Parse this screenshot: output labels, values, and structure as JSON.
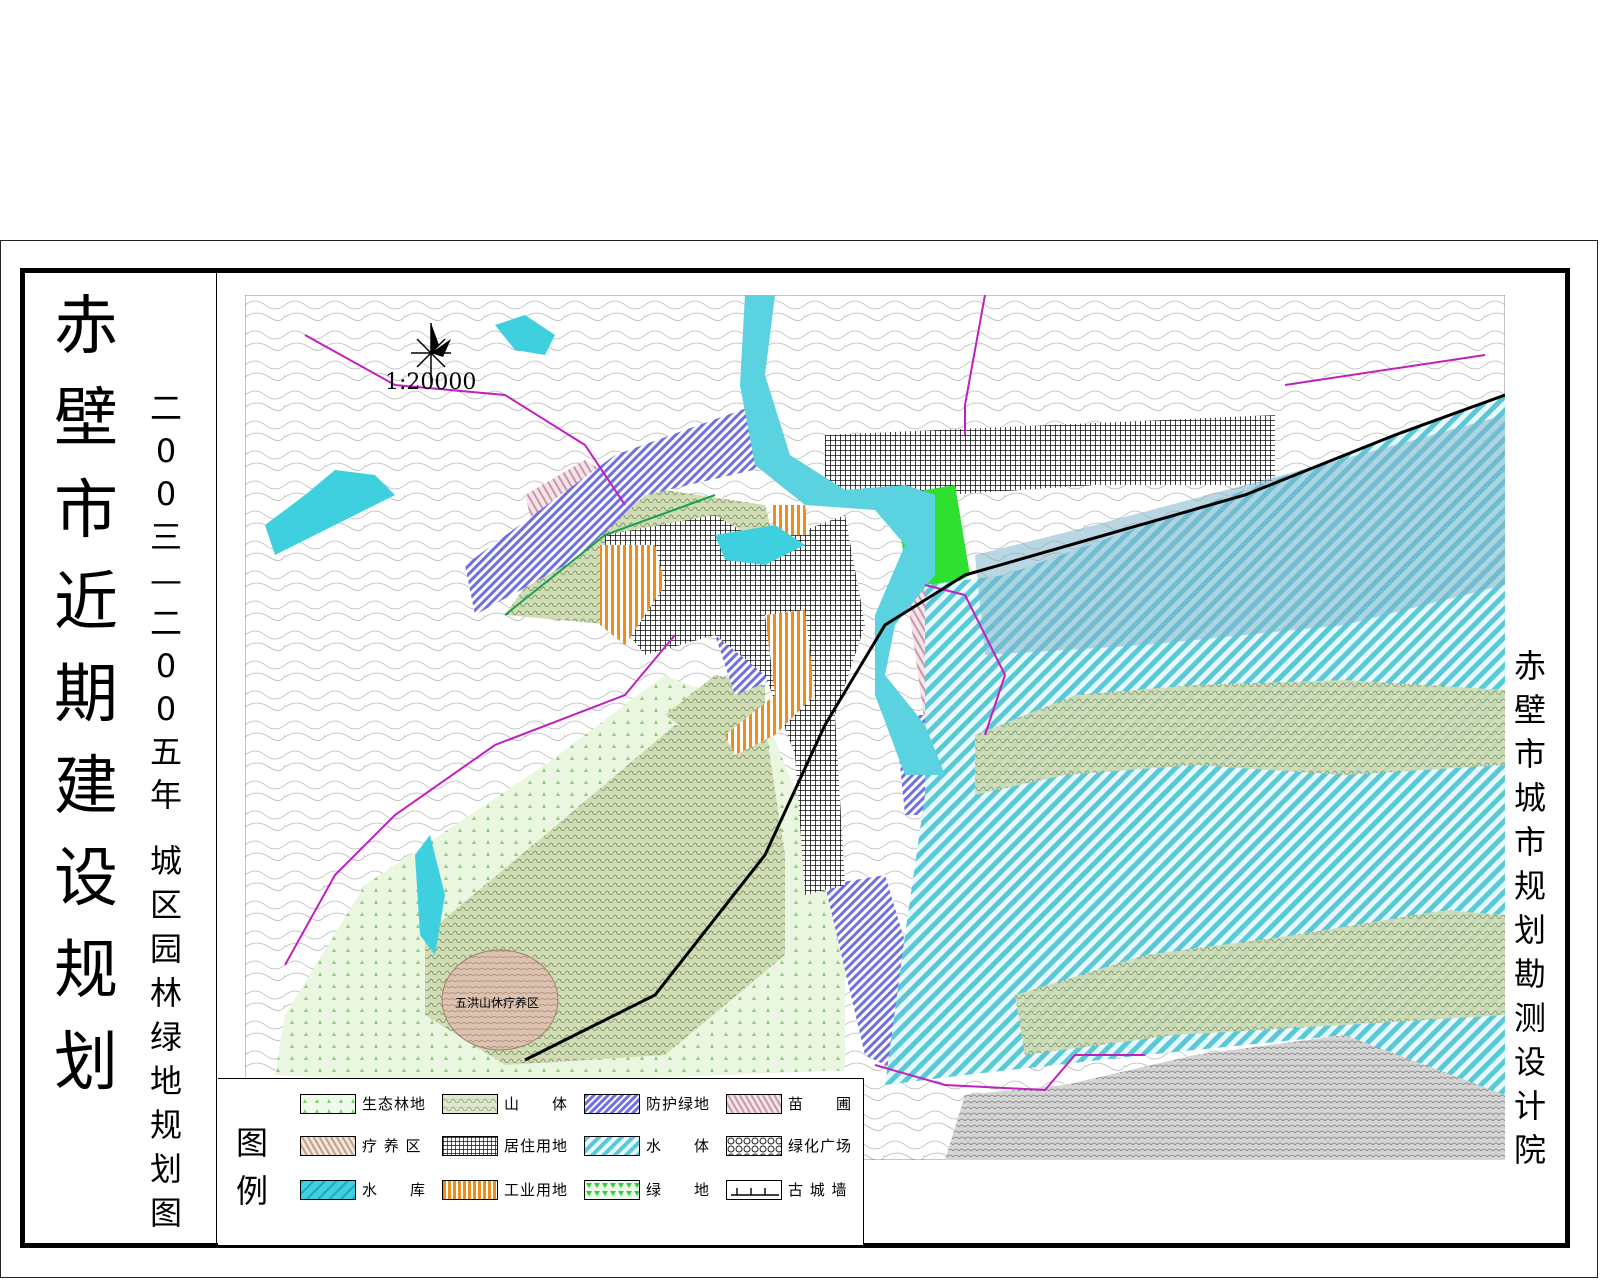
{
  "title": {
    "main": [
      "赤",
      "壁",
      "市",
      "近",
      "期",
      "建",
      "设",
      "规",
      "划"
    ],
    "date_range": [
      "二",
      "0",
      "0",
      "三",
      "—",
      "二",
      "0",
      "0",
      "五",
      "年"
    ],
    "subtitle": [
      "城",
      "区",
      "园",
      "林",
      "绿",
      "地",
      "规",
      "划",
      "图"
    ],
    "organization": [
      "赤",
      "壁",
      "市",
      "城",
      "市",
      "规",
      "划",
      "勘",
      "测",
      "设",
      "计",
      "院"
    ]
  },
  "map": {
    "scale": "1:20000",
    "place_label": "五洪山休疗养区",
    "compass": "north-arrow-icon"
  },
  "legend": {
    "title": [
      "图",
      "例"
    ],
    "items": [
      {
        "label": "生态林地",
        "pattern": "eco-forest",
        "color": "#9be29b"
      },
      {
        "label": "山　　体",
        "pattern": "mountain",
        "color": "#c8d8b0"
      },
      {
        "label": "防护绿地",
        "pattern": "protective-green",
        "color": "#7777dd"
      },
      {
        "label": "苗　　圃",
        "pattern": "nursery",
        "color": "#d8a8b8"
      },
      {
        "label": "疗 养 区",
        "pattern": "sanatorium",
        "color": "#c8a890"
      },
      {
        "label": "居住用地",
        "pattern": "residential",
        "color": "#222222"
      },
      {
        "label": "水　　体",
        "pattern": "water-body",
        "color": "#5ac8d8"
      },
      {
        "label": "绿化广场",
        "pattern": "green-plaza",
        "color": "#444444"
      },
      {
        "label": "水　　库",
        "pattern": "reservoir",
        "color": "#40d0e0"
      },
      {
        "label": "工业用地",
        "pattern": "industrial",
        "color": "#f08c1e"
      },
      {
        "label": "绿　　地",
        "pattern": "green-space",
        "color": "#30d030"
      },
      {
        "label": "古 城 墙",
        "pattern": "ancient-wall",
        "color": "#000000"
      }
    ]
  },
  "colors": {
    "water": "#5ac8d8",
    "reservoir": "#40d0e0",
    "protective": "#7777dd",
    "residential": "#111111",
    "industrial": "#f08c1e",
    "green": "#30e030",
    "mountain": "#b8cc98",
    "eco": "#ccecc0",
    "nursery": "#d8b0c0",
    "road": "#c020c0",
    "rail": "#000000"
  }
}
